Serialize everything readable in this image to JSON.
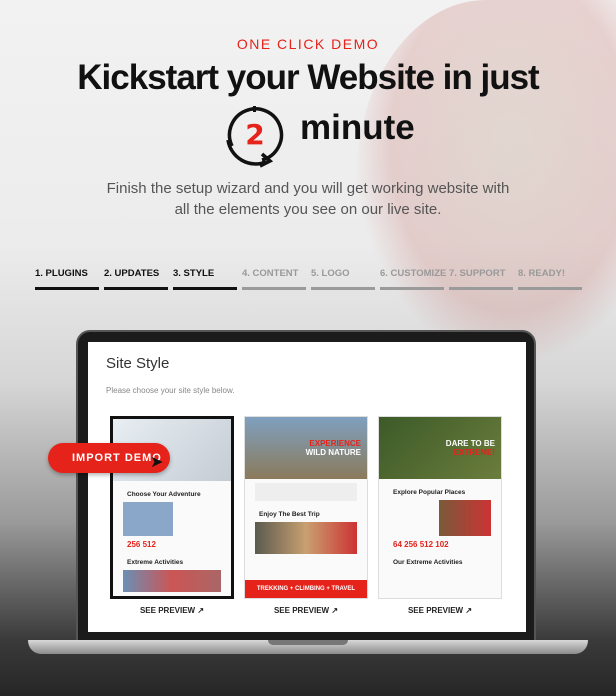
{
  "header": {
    "eyebrow": "ONE CLICK DEMO",
    "headline": "Kickstart your Website in just",
    "clock_number": "2",
    "minute": "minute",
    "subtitle_line1": "Finish the setup wizard and you will get working website with",
    "subtitle_line2": "all the elements you see on our live site."
  },
  "steps": [
    {
      "label": "1. PLUGINS",
      "done": true
    },
    {
      "label": "2. UPDATES",
      "done": true
    },
    {
      "label": "3. STYLE",
      "done": true
    },
    {
      "label": "4. CONTENT",
      "done": false
    },
    {
      "label": "5. LOGO",
      "done": false
    },
    {
      "label": "6. CUSTOMIZE",
      "done": false
    },
    {
      "label": "7. SUPPORT",
      "done": false
    },
    {
      "label": "8. READY!",
      "done": false
    }
  ],
  "screen": {
    "title": "Site Style",
    "description": "Please choose your site style below.",
    "cards": [
      {
        "hero": "",
        "section1": "Choose Your Adventure",
        "stats": "256  512",
        "section2": "Extreme Activities",
        "preview": "SEE PREVIEW",
        "selected": true
      },
      {
        "hero_line1": "EXPERIENCE",
        "hero_line2": "WILD NATURE",
        "section1": "Enjoy The Best Trip",
        "band": "TREKKING + CLIMBING + TRAVEL",
        "preview": "SEE PREVIEW"
      },
      {
        "hero_line1": "DARE TO BE",
        "hero_line2": "EXTREME!",
        "section1": "Explore Popular Places",
        "stats": "64  256  512  102",
        "section2": "Our Extreme Activities",
        "preview": "SEE PREVIEW"
      }
    ]
  },
  "import_button": "IMPORT DEMO",
  "colors": {
    "accent": "#e5231b",
    "text": "#111111"
  }
}
